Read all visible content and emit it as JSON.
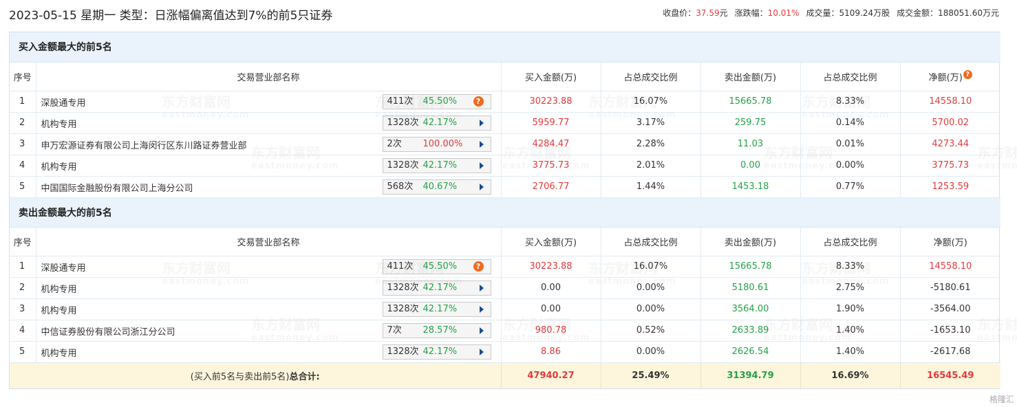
{
  "header": {
    "title": "2023-05-15 星期一 类型：日涨幅偏离值达到7%的前5只证券",
    "close_label": "收盘价：",
    "close_value": "37.59",
    "close_unit": "元",
    "change_label": "涨跌幅：",
    "change_value": "10.01%",
    "volume_label": "成交量：",
    "volume_value": "5109.24万股",
    "amount_label": "成交金额：",
    "amount_value": "188051.60万元"
  },
  "columns": [
    "序号",
    "交易营业部名称",
    "买入金额(万)",
    "占总成交比例",
    "卖出金额(万)",
    "占总成交比例",
    "净额(万)"
  ],
  "buy_section": {
    "title": "买入金额最大的前5名",
    "rows": [
      {
        "seq": "1",
        "name": "深股通专用",
        "count": "411次",
        "rate": "45.50%",
        "rate_color": "green",
        "icon": "question-icon",
        "buy": "30223.88",
        "buy_pct": "16.07%",
        "sell": "15665.78",
        "sell_pct": "8.33%",
        "net": "14558.10",
        "net_color": "red"
      },
      {
        "seq": "2",
        "name": "机构专用",
        "count": "1328次",
        "rate": "42.17%",
        "rate_color": "green",
        "icon": "arrow-right-icon",
        "buy": "5959.77",
        "buy_pct": "3.17%",
        "sell": "259.75",
        "sell_pct": "0.14%",
        "net": "5700.02",
        "net_color": "red"
      },
      {
        "seq": "3",
        "name": "申万宏源证券有限公司上海闵行区东川路证券营业部",
        "count": "2次",
        "rate": "100.00%",
        "rate_color": "red",
        "icon": "arrow-right-icon",
        "buy": "4284.47",
        "buy_pct": "2.28%",
        "sell": "11.03",
        "sell_pct": "0.01%",
        "net": "4273.44",
        "net_color": "red"
      },
      {
        "seq": "4",
        "name": "机构专用",
        "count": "1328次",
        "rate": "42.17%",
        "rate_color": "green",
        "icon": "arrow-right-icon",
        "buy": "3775.73",
        "buy_pct": "2.01%",
        "sell": "0.00",
        "sell_pct": "0.00%",
        "net": "3775.73",
        "net_color": "red"
      },
      {
        "seq": "5",
        "name": "中国国际金融股份有限公司上海分公司",
        "count": "568次",
        "rate": "40.67%",
        "rate_color": "green",
        "icon": "arrow-right-icon",
        "buy": "2706.77",
        "buy_pct": "1.44%",
        "sell": "1453.18",
        "sell_pct": "0.77%",
        "net": "1253.59",
        "net_color": "red"
      }
    ]
  },
  "sell_section": {
    "title": "卖出金额最大的前5名",
    "rows": [
      {
        "seq": "1",
        "name": "深股通专用",
        "count": "411次",
        "rate": "45.50%",
        "rate_color": "green",
        "icon": "question-icon",
        "buy": "30223.88",
        "buy_color": "red",
        "buy_pct": "16.07%",
        "sell": "15665.78",
        "sell_pct": "8.33%",
        "net": "14558.10",
        "net_color": "red"
      },
      {
        "seq": "2",
        "name": "机构专用",
        "count": "1328次",
        "rate": "42.17%",
        "rate_color": "green",
        "icon": "arrow-right-icon",
        "buy": "0.00",
        "buy_color": "plain",
        "buy_pct": "0.00%",
        "sell": "5180.61",
        "sell_pct": "2.75%",
        "net": "-5180.61",
        "net_color": "plain"
      },
      {
        "seq": "3",
        "name": "机构专用",
        "count": "1328次",
        "rate": "42.17%",
        "rate_color": "green",
        "icon": "arrow-right-icon",
        "buy": "0.00",
        "buy_color": "plain",
        "buy_pct": "0.00%",
        "sell": "3564.00",
        "sell_pct": "1.90%",
        "net": "-3564.00",
        "net_color": "plain"
      },
      {
        "seq": "4",
        "name": "中信证券股份有限公司浙江分公司",
        "count": "7次",
        "rate": "28.57%",
        "rate_color": "green",
        "icon": "arrow-right-icon",
        "buy": "980.78",
        "buy_color": "red",
        "buy_pct": "0.52%",
        "sell": "2633.89",
        "sell_pct": "1.40%",
        "net": "-1653.10",
        "net_color": "plain"
      },
      {
        "seq": "5",
        "name": "机构专用",
        "count": "1328次",
        "rate": "42.17%",
        "rate_color": "green",
        "icon": "arrow-right-icon",
        "buy": "8.86",
        "buy_color": "red",
        "buy_pct": "0.00%",
        "sell": "2626.54",
        "sell_pct": "1.40%",
        "net": "-2617.68",
        "net_color": "plain"
      }
    ]
  },
  "total": {
    "label_prefix": "(买入前5名与卖出前5名)",
    "label_bold": "总合计:",
    "buy": "47940.27",
    "buy_pct": "25.49%",
    "sell": "31394.79",
    "sell_pct": "16.69%",
    "net": "16545.49"
  },
  "watermark": {
    "cn": "东方财富网",
    "en": "eastmoney.com"
  },
  "corner_logo": "格隆汇",
  "colors": {
    "red": "#e4393c",
    "green": "#24a148",
    "header_bg": "#eaf3fb",
    "total_bg": "#fdf6dc",
    "icon_orange": "#f06a1e"
  }
}
